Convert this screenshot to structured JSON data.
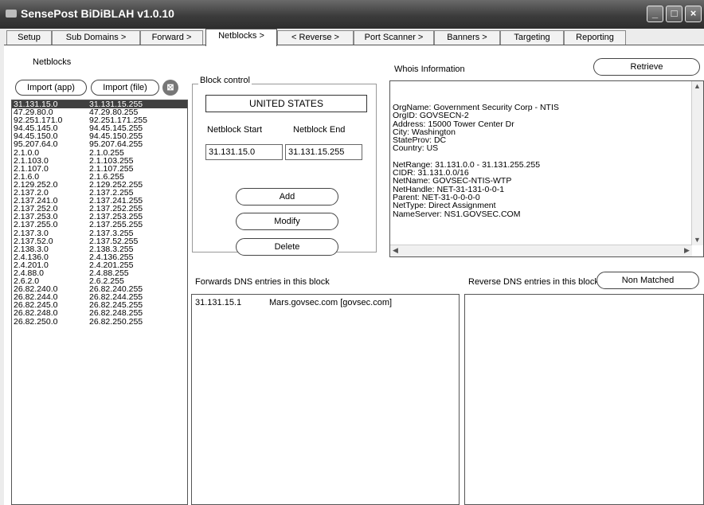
{
  "window": {
    "title": "SensePost BiDiBLAH v1.0.10"
  },
  "tabs": [
    "Setup",
    "Sub Domains >",
    "Forward >",
    "Netblocks >",
    "< Reverse >",
    "Port Scanner >",
    "Banners >",
    "Targeting",
    "Reporting"
  ],
  "netblocks": {
    "heading": "Netblocks",
    "import_app": "Import (app)",
    "import_file": "Import (file)",
    "rows": [
      [
        "31.131.15.0",
        "31.131.15.255"
      ],
      [
        "47.29.80.0",
        "47.29.80.255"
      ],
      [
        "92.251.171.0",
        "92.251.171.255"
      ],
      [
        "94.45.145.0",
        "94.45.145.255"
      ],
      [
        "94.45.150.0",
        "94.45.150.255"
      ],
      [
        "95.207.64.0",
        "95.207.64.255"
      ],
      [
        "2.1.0.0",
        "2.1.0.255"
      ],
      [
        "2.1.103.0",
        "2.1.103.255"
      ],
      [
        "2.1.107.0",
        "2.1.107.255"
      ],
      [
        "2.1.6.0",
        "2.1.6.255"
      ],
      [
        "2.129.252.0",
        "2.129.252.255"
      ],
      [
        "2.137.2.0",
        "2.137.2.255"
      ],
      [
        "2.137.241.0",
        "2.137.241.255"
      ],
      [
        "2.137.252.0",
        "2.137.252.255"
      ],
      [
        "2.137.253.0",
        "2.137.253.255"
      ],
      [
        "2.137.255.0",
        "2.137.255.255"
      ],
      [
        "2.137.3.0",
        "2.137.3.255"
      ],
      [
        "2.137.52.0",
        "2.137.52.255"
      ],
      [
        "2.138.3.0",
        "2.138.3.255"
      ],
      [
        "2.4.136.0",
        "2.4.136.255"
      ],
      [
        "2.4.201.0",
        "2.4.201.255"
      ],
      [
        "2.4.88.0",
        "2.4.88.255"
      ],
      [
        "2.6.2.0",
        "2.6.2.255"
      ],
      [
        "26.82.240.0",
        "26.82.240.255"
      ],
      [
        "26.82.244.0",
        "26.82.244.255"
      ],
      [
        "26.82.245.0",
        "26.82.245.255"
      ],
      [
        "26.82.248.0",
        "26.82.248.255"
      ],
      [
        "26.82.250.0",
        "26.82.250.255"
      ]
    ]
  },
  "block_control": {
    "legend": "Block control",
    "country": "UNITED STATES",
    "start_label": "Netblock Start",
    "end_label": "Netblock End",
    "start_value": "31.131.15.0",
    "end_value": "31.131.15.255",
    "add": "Add",
    "modify": "Modify",
    "delete": "Delete"
  },
  "whois": {
    "heading": "Whois Information",
    "retrieve": "Retrieve",
    "block1": [
      "OrgName:   Government Security Corp - NTIS",
      "OrgID:     GOVSECN-2",
      "Address:   15000 Tower Center Dr",
      "City:      Washington",
      "StateProv: DC",
      "Country:   US"
    ],
    "block2": [
      "NetRange:  31.131.0.0 - 31.131.255.255",
      "CIDR:      31.131.0.0/16",
      "NetName:   GOVSEC-NTIS-WTP",
      "NetHandle: NET-31-131-0-0-1",
      "Parent:    NET-31-0-0-0-0",
      "NetType:   Direct Assignment",
      "NameServer: NS1.GOVSEC.COM"
    ]
  },
  "forward_dns": {
    "heading": "Forwards DNS entries in this block",
    "entries": [
      {
        "ip": "31.131.15.1",
        "host": "Mars.govsec.com  [govsec.com]"
      }
    ]
  },
  "reverse_dns": {
    "heading": "Reverse DNS entries in this block",
    "button": "Non Matched"
  }
}
